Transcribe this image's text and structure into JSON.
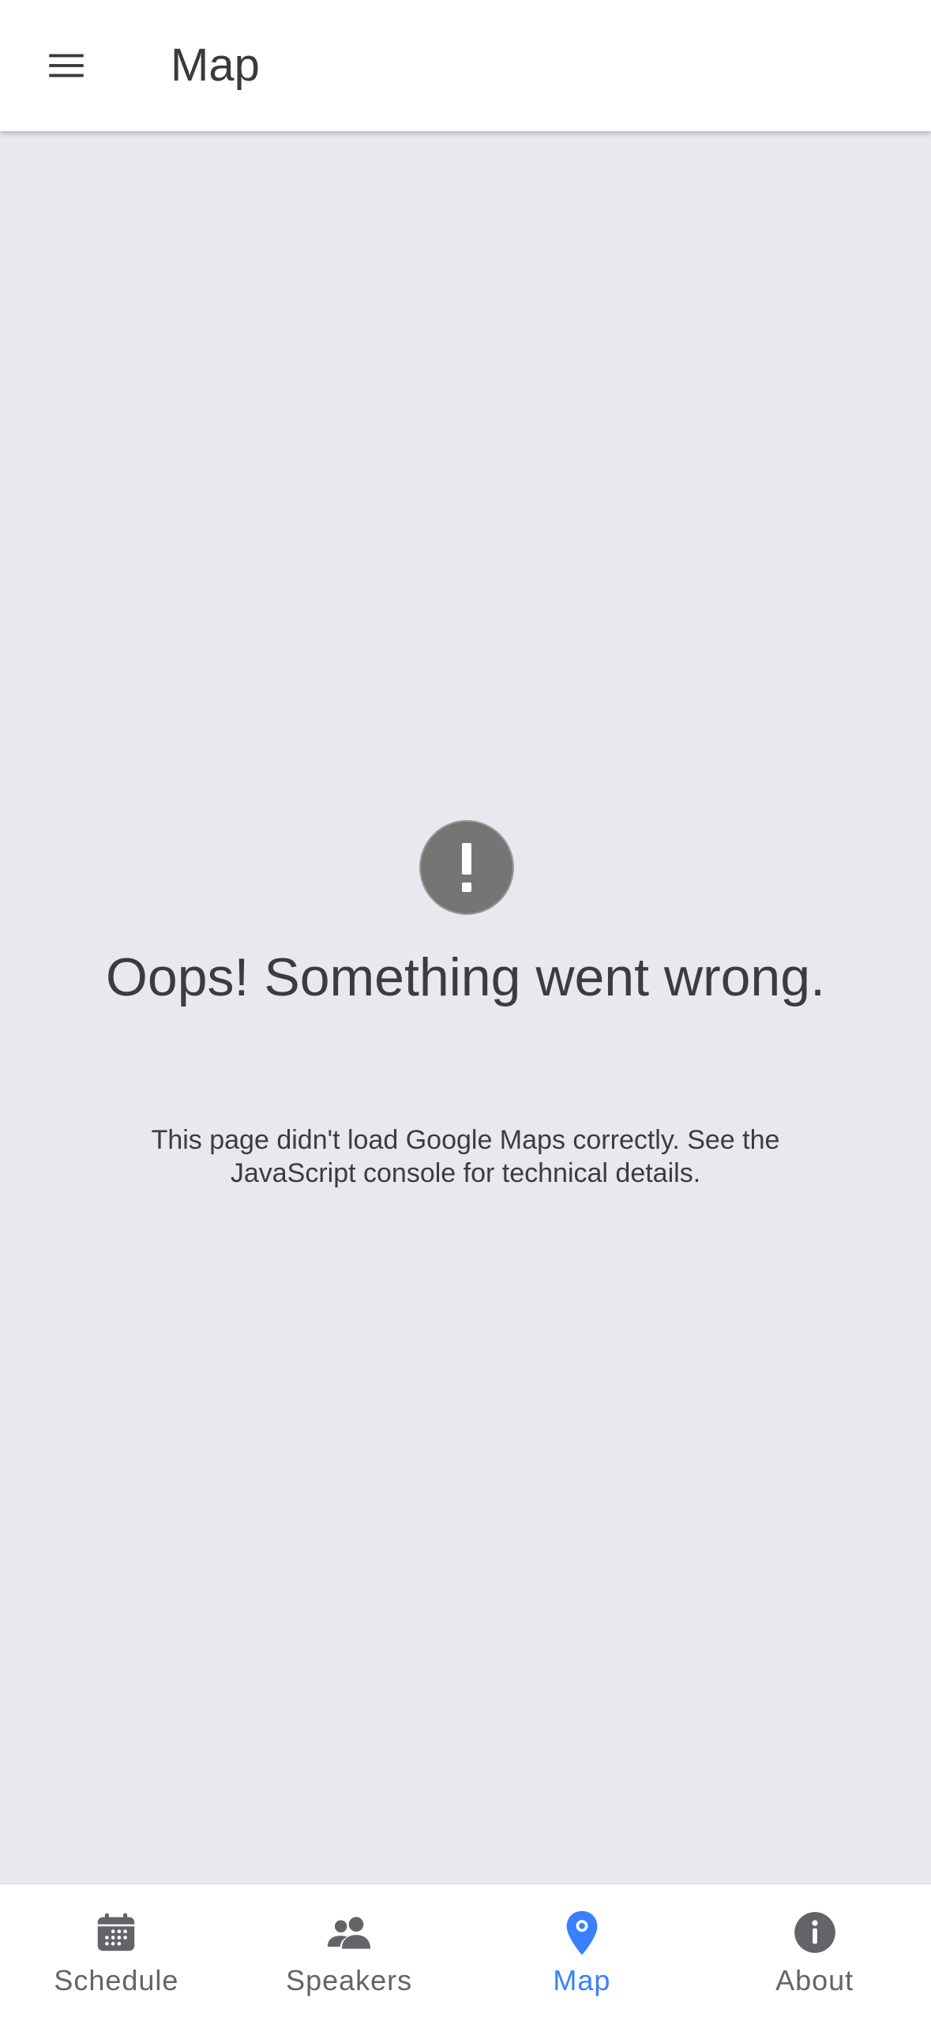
{
  "toolbar": {
    "title": "Map",
    "menu_icon": "hamburger-menu-icon"
  },
  "error": {
    "icon": "exclamation-circle-icon",
    "title": "Oops! Something went wrong.",
    "message": "This page didn't load Google Maps correctly. See the JavaScript console for technical details."
  },
  "tabs": [
    {
      "label": "Schedule",
      "icon": "calendar-icon",
      "active": false
    },
    {
      "label": "Speakers",
      "icon": "people-icon",
      "active": false
    },
    {
      "label": "Map",
      "icon": "location-pin-icon",
      "active": true
    },
    {
      "label": "About",
      "icon": "info-circle-icon",
      "active": false
    }
  ],
  "colors": {
    "accent": "#3880ff",
    "inactive_tab": "#646468",
    "background": "#e8e9ee",
    "error_icon": "#757575"
  }
}
